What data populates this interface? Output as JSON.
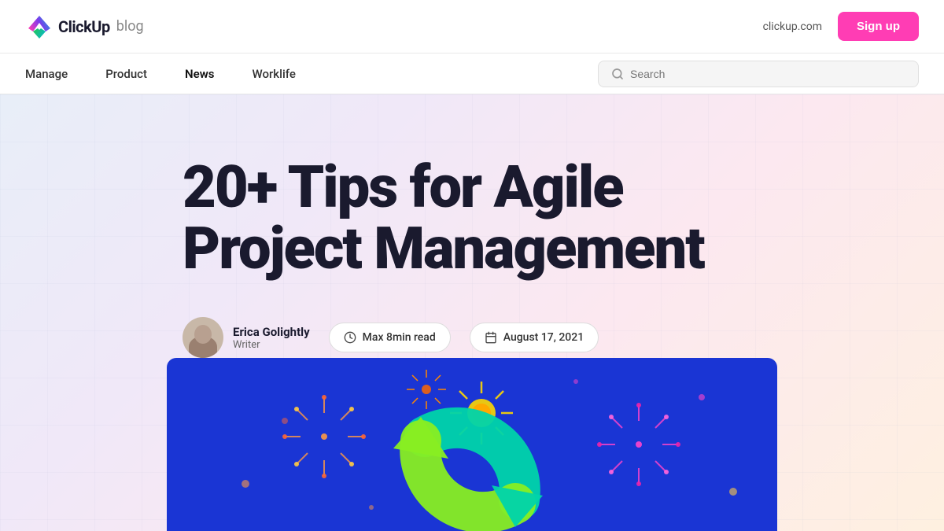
{
  "header": {
    "logo_text": "ClickUp",
    "logo_blog": "blog",
    "external_link": "clickup.com",
    "signup_label": "Sign up"
  },
  "nav": {
    "links": [
      {
        "id": "manage",
        "label": "Manage",
        "active": false
      },
      {
        "id": "product",
        "label": "Product",
        "active": false
      },
      {
        "id": "news",
        "label": "News",
        "active": false
      },
      {
        "id": "worklife",
        "label": "Worklife",
        "active": false
      }
    ],
    "search": {
      "placeholder": "Search"
    }
  },
  "hero": {
    "title": "20+ Tips for Agile Project Management",
    "author": {
      "name": "Erica Golightly",
      "role": "Writer"
    },
    "read_time": "Max 8min read",
    "date": "August 17, 2021"
  },
  "colors": {
    "signup_bg": "#ff3db4",
    "article_bg": "#1a35d4"
  }
}
